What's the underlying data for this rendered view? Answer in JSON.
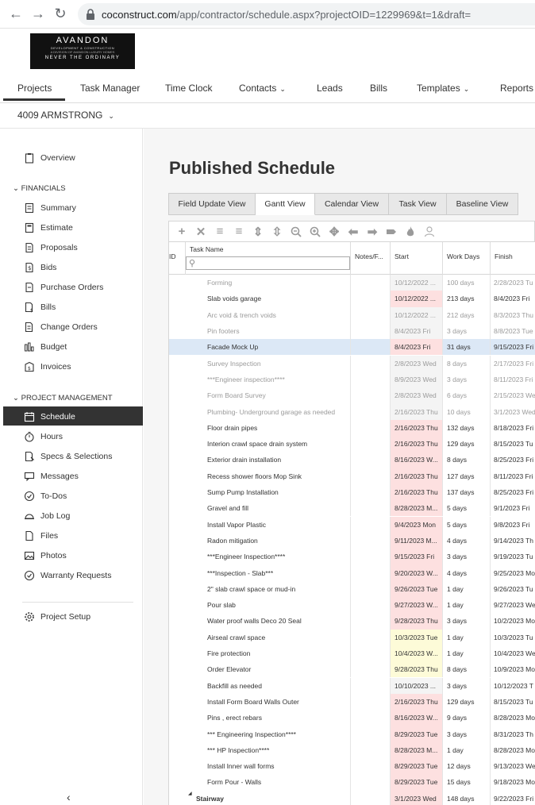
{
  "browser": {
    "url_domain": "coconstruct.com",
    "url_path": "/app/contractor/schedule.aspx?projectOID=1229969&t=1&draft="
  },
  "logo": {
    "line1": "AVANDON",
    "line2": "DEVELOPMENT & CONSTRUCTION",
    "line3": "A DIVISION OF AVANDON LUXURY HOMES",
    "line4": "NEVER THE ORDINARY"
  },
  "topnav": {
    "items": [
      "Projects",
      "Task Manager",
      "Time Clock",
      "Contacts",
      "Leads",
      "Bills",
      "Templates",
      "Reports"
    ]
  },
  "project": {
    "name": "4009 ARMSTRONG"
  },
  "sidebar": {
    "overview": "Overview",
    "financials_label": "FINANCIALS",
    "financials": [
      "Summary",
      "Estimate",
      "Proposals",
      "Bids",
      "Purchase Orders",
      "Bills",
      "Change Orders",
      "Budget",
      "Invoices"
    ],
    "pm_label": "PROJECT MANAGEMENT",
    "pm": [
      "Schedule",
      "Hours",
      "Specs & Selections",
      "Messages",
      "To-Dos",
      "Job Log",
      "Files",
      "Photos",
      "Warranty Requests"
    ],
    "setup": "Project Setup",
    "collapse": "‹"
  },
  "page": {
    "title": "Published Schedule"
  },
  "tabs": [
    "Field Update View",
    "Gantt View",
    "Calendar View",
    "Task View",
    "Baseline View"
  ],
  "grid": {
    "headers": {
      "id": "ID",
      "task": "Task Name",
      "notes": "Notes/F...",
      "start": "Start",
      "days": "Work Days",
      "finish": "Finish"
    },
    "rows": [
      {
        "name": "Forming",
        "start": "10/12/2022 ...",
        "days": "100 days",
        "finish": "2/28/2023 Tu",
        "style": "muted",
        "sbg": "grey"
      },
      {
        "name": "Slab voids garage",
        "start": "10/12/2022 ...",
        "days": "213 days",
        "finish": "8/4/2023 Fri",
        "style": "normal",
        "sbg": "red"
      },
      {
        "name": "Arc void & trench voids",
        "start": "10/12/2022 ...",
        "days": "212 days",
        "finish": "8/3/2023 Thu",
        "style": "muted",
        "sbg": "grey"
      },
      {
        "name": "Pin footers",
        "start": "8/4/2023 Fri",
        "days": "3 days",
        "finish": "8/8/2023 Tue",
        "style": "muted",
        "sbg": "grey"
      },
      {
        "name": "Facade Mock Up",
        "start": "8/4/2023 Fri",
        "days": "31 days",
        "finish": "9/15/2023 Fri",
        "style": "hl",
        "sbg": "red"
      },
      {
        "name": "Survey Inspection",
        "start": "2/8/2023 Wed",
        "days": "8 days",
        "finish": "2/17/2023 Fri",
        "style": "muted",
        "sbg": "grey"
      },
      {
        "name": "***Engineer inspection****",
        "start": "8/9/2023 Wed",
        "days": "3 days",
        "finish": "8/11/2023 Fri",
        "style": "muted",
        "sbg": "grey"
      },
      {
        "name": "Form Board Survey",
        "start": "2/8/2023 Wed",
        "days": "6 days",
        "finish": "2/15/2023 We",
        "style": "muted",
        "sbg": "grey"
      },
      {
        "name": "Plumbing- Underground garage as needed",
        "start": "2/16/2023 Thu",
        "days": "10 days",
        "finish": "3/1/2023 Wed",
        "style": "muted",
        "sbg": "grey"
      },
      {
        "name": "Floor drain pipes",
        "start": "2/16/2023 Thu",
        "days": "132 days",
        "finish": "8/18/2023 Fri",
        "style": "normal",
        "sbg": "red"
      },
      {
        "name": "Interion crawl space drain system",
        "start": "2/16/2023 Thu",
        "days": "129 days",
        "finish": "8/15/2023 Tu",
        "style": "normal",
        "sbg": "red"
      },
      {
        "name": "Exterior drain installation",
        "start": "8/16/2023 W...",
        "days": "8 days",
        "finish": "8/25/2023 Fri",
        "style": "normal",
        "sbg": "red"
      },
      {
        "name": "Recess shower floors Mop Sink",
        "start": "2/16/2023 Thu",
        "days": "127 days",
        "finish": "8/11/2023 Fri",
        "style": "normal",
        "sbg": "red"
      },
      {
        "name": "Sump Pump Installation",
        "start": "2/16/2023 Thu",
        "days": "137 days",
        "finish": "8/25/2023 Fri",
        "style": "normal",
        "sbg": "red"
      },
      {
        "name": "Gravel and fill",
        "start": "8/28/2023 M...",
        "days": "5 days",
        "finish": "9/1/2023 Fri",
        "style": "normal",
        "sbg": "red"
      },
      {
        "name": "Install Vapor Plastic",
        "start": "9/4/2023 Mon",
        "days": "5 days",
        "finish": "9/8/2023 Fri",
        "style": "normal",
        "sbg": "red"
      },
      {
        "name": "Radon mitigation",
        "start": "9/11/2023 M...",
        "days": "4 days",
        "finish": "9/14/2023 Th",
        "style": "normal",
        "sbg": "red"
      },
      {
        "name": "***Engineer Inspection****",
        "start": "9/15/2023 Fri",
        "days": "3 days",
        "finish": "9/19/2023 Tu",
        "style": "normal",
        "sbg": "red"
      },
      {
        "name": "***Inspection - Slab***",
        "start": "9/20/2023 W...",
        "days": "4 days",
        "finish": "9/25/2023 Mo",
        "style": "normal",
        "sbg": "red"
      },
      {
        "name": "2\" slab crawl space or mud-in",
        "start": "9/26/2023 Tue",
        "days": "1 day",
        "finish": "9/26/2023 Tu",
        "style": "normal",
        "sbg": "red"
      },
      {
        "name": "Pour slab",
        "start": "9/27/2023 W...",
        "days": "1 day",
        "finish": "9/27/2023 We",
        "style": "normal",
        "sbg": "red"
      },
      {
        "name": "Water proof walls Deco 20 Seal",
        "start": "9/28/2023 Thu",
        "days": "3 days",
        "finish": "10/2/2023 Mo",
        "style": "normal",
        "sbg": "red"
      },
      {
        "name": "Airseal crawl space",
        "start": "10/3/2023 Tue",
        "days": "1 day",
        "finish": "10/3/2023 Tu",
        "style": "normal",
        "sbg": "yel"
      },
      {
        "name": "Fire protection",
        "start": "10/4/2023 W...",
        "days": "1 day",
        "finish": "10/4/2023 We",
        "style": "normal",
        "sbg": "yel"
      },
      {
        "name": "Order Elevator",
        "start": "9/28/2023 Thu",
        "days": "8 days",
        "finish": "10/9/2023 Mo",
        "style": "normal",
        "sbg": "yel"
      },
      {
        "name": "Backfill as needed",
        "start": "10/10/2023 ...",
        "days": "3 days",
        "finish": "10/12/2023 T",
        "style": "normal",
        "sbg": "grey"
      },
      {
        "name": "Install Form Board Walls Outer",
        "start": "2/16/2023 Thu",
        "days": "129 days",
        "finish": "8/15/2023 Tu",
        "style": "normal",
        "sbg": "red"
      },
      {
        "name": "Pins , erect rebars",
        "start": "8/16/2023 W...",
        "days": "9 days",
        "finish": "8/28/2023 Mo",
        "style": "normal",
        "sbg": "red"
      },
      {
        "name": "*** Engineering Inspection****",
        "start": "8/29/2023 Tue",
        "days": "3 days",
        "finish": "8/31/2023 Th",
        "style": "normal",
        "sbg": "red"
      },
      {
        "name": "*** HP Inspection****",
        "start": "8/28/2023 M...",
        "days": "1 day",
        "finish": "8/28/2023 Mo",
        "style": "normal",
        "sbg": "red"
      },
      {
        "name": "Install Inner wall forms",
        "start": "8/29/2023 Tue",
        "days": "12 days",
        "finish": "9/13/2023 We",
        "style": "normal",
        "sbg": "red"
      },
      {
        "name": "Form Pour - Walls",
        "start": "8/29/2023 Tue",
        "days": "15 days",
        "finish": "9/18/2023 Mo",
        "style": "normal",
        "sbg": "red"
      },
      {
        "name": "Stairway",
        "start": "3/1/2023 Wed",
        "days": "148 days",
        "finish": "9/22/2023 Fri",
        "style": "group",
        "sbg": "red"
      }
    ]
  },
  "colors": {
    "late_red": "#fde0e0",
    "upcoming_yellow": "#fdfbd8",
    "selected_blue": "#dce8f6",
    "active_nav": "#333333"
  }
}
